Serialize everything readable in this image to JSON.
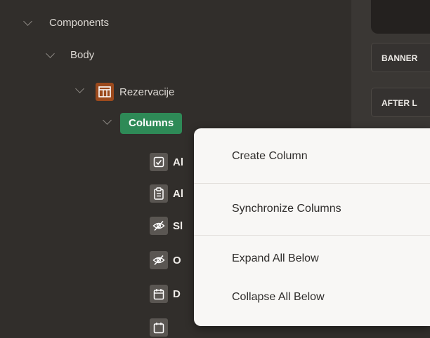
{
  "tree": {
    "components_label": "Components",
    "body_label": "Body",
    "region_label": "Rezervacije",
    "columns_label": "Columns",
    "columns": [
      {
        "label": "Al",
        "icon": "checkbox-icon"
      },
      {
        "label": "Al",
        "icon": "clipboard-icon"
      },
      {
        "label": "Sl",
        "icon": "hidden-eye-icon"
      },
      {
        "label": "O",
        "icon": "hidden-eye-icon"
      },
      {
        "label": "D",
        "icon": "calendar-icon"
      }
    ]
  },
  "right_panel": {
    "slots": [
      "BANNER",
      "AFTER L"
    ]
  },
  "context_menu": {
    "items": [
      "Create Column",
      "Synchronize Columns",
      "Expand All Below",
      "Collapse All Below"
    ]
  },
  "colors": {
    "tree_bg": "#312e2b",
    "menu_bg": "#f8f7f5",
    "selected_green": "#2e8a57",
    "region_orange": "#9c4a1d"
  }
}
